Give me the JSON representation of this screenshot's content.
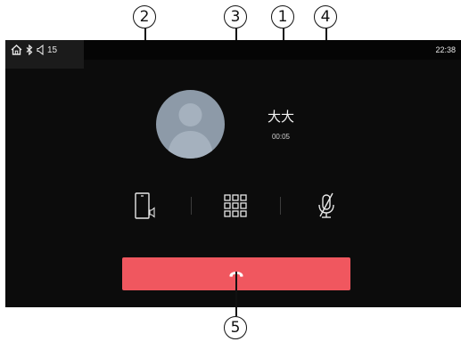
{
  "annotations": {
    "callouts": [
      "1",
      "2",
      "3",
      "4",
      "5"
    ]
  },
  "status_bar": {
    "icons": [
      "home-icon",
      "bluetooth-icon",
      "volume-icon"
    ],
    "volume_level": "15",
    "time": "22:38"
  },
  "call": {
    "caller_name": "大大",
    "duration": "00:05",
    "avatar": "default-avatar-icon"
  },
  "controls": {
    "items": [
      {
        "name": "phone-audio-switch",
        "icon": "phone-speaker-icon"
      },
      {
        "name": "keypad",
        "icon": "keypad-icon"
      },
      {
        "name": "mute",
        "icon": "mic-muted-icon"
      }
    ]
  },
  "hangup": {
    "icon": "hang-up-icon",
    "color": "#f0575f"
  },
  "colors": {
    "screen_bg": "#0c0c0c",
    "avatar_bg": "#8d9aa8",
    "hangup_bg": "#f0575f"
  }
}
